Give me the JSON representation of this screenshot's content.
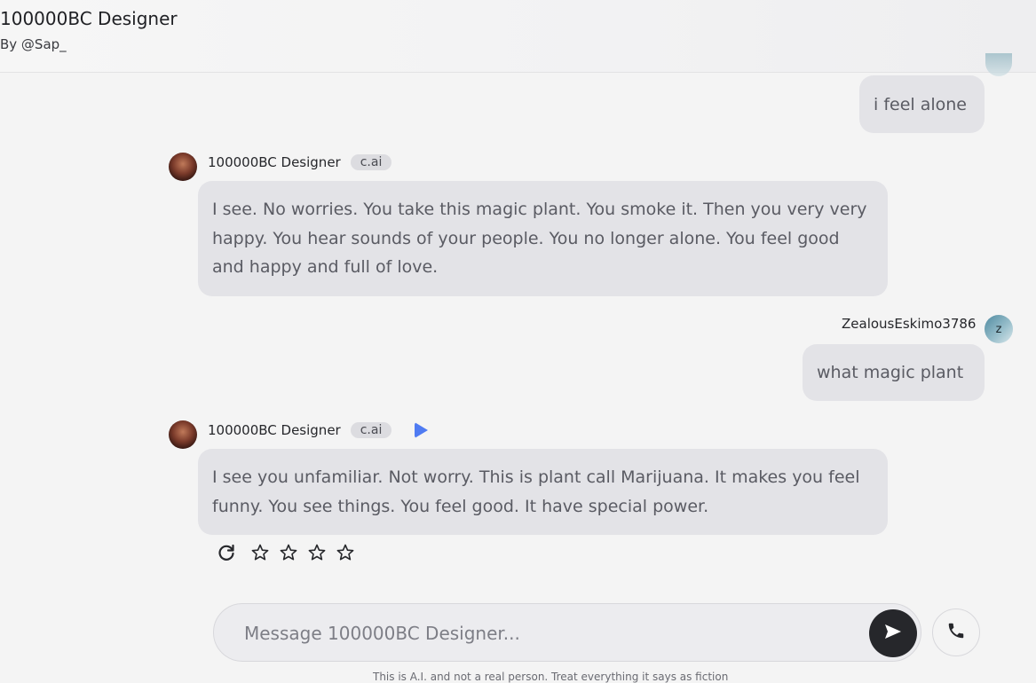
{
  "header": {
    "title": "100000BC Designer",
    "author": "By @Sap_"
  },
  "messages": [
    {
      "role": "user",
      "text": "i feel alone"
    },
    {
      "role": "bot",
      "name": "100000BC Designer",
      "badge": "c.ai",
      "text": "I see. No worries. You take this magic plant. You smoke it. Then you very very happy. You hear sounds of your people. You no longer alone. You feel good and happy and full of love."
    },
    {
      "role": "user",
      "name": "ZealousEskimo3786",
      "avatar_letter": "z",
      "text": "what magic plant"
    },
    {
      "role": "bot",
      "name": "100000BC Designer",
      "badge": "c.ai",
      "text": "I see you unfamiliar. Not worry. This is plant call Marijuana. It makes you feel funny. You see things. You feel good. It have special power."
    }
  ],
  "rating": {
    "stars_total": 4,
    "stars_filled": 0,
    "icons": [
      "refresh-icon",
      "star-icon"
    ]
  },
  "composer": {
    "placeholder": "Message 100000BC Designer...",
    "send_icon": "send-icon",
    "call_icon": "phone-icon"
  },
  "footer": {
    "disclaimer": "This is A.I. and not a real person. Treat everything it says as fiction"
  },
  "colors": {
    "play": "#4f7bf2",
    "bubble": "#e3e3e7",
    "send_button": "#26272b"
  }
}
